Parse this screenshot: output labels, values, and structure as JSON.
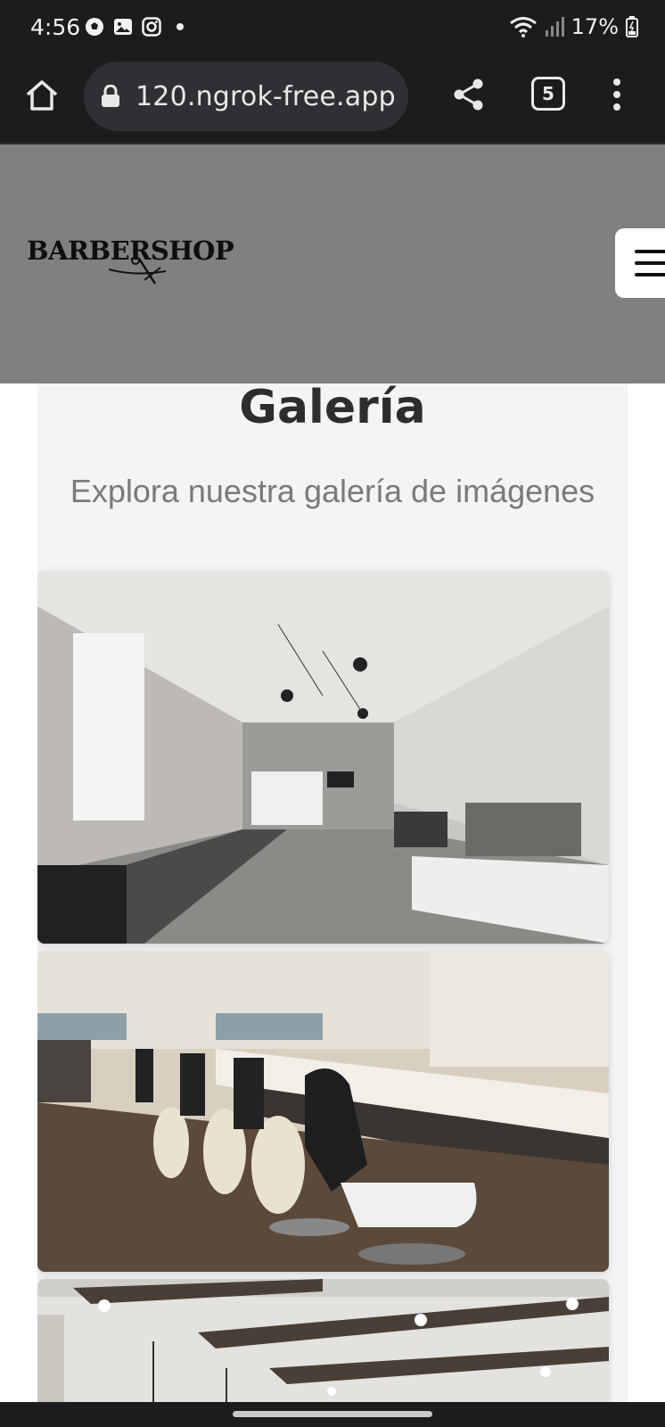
{
  "status_bar": {
    "time": "4:56",
    "battery": "17%",
    "icons_left": [
      "soccer-ball-icon",
      "gallery-icon",
      "instagram-icon",
      "dot-icon"
    ],
    "icons_right": [
      "wifi-icon",
      "signal-icon",
      "battery-icon"
    ]
  },
  "browser": {
    "url": "120.ngrok-free.app",
    "tab_count": "5",
    "icons": [
      "home-icon",
      "lock-icon",
      "share-icon",
      "tabs-icon",
      "more-vert-icon"
    ]
  },
  "site_header": {
    "logo_text_part1": "Barber",
    "logo_text_part2": "Shop",
    "menu_icon": "hamburger-icon"
  },
  "gallery": {
    "title": "Galería",
    "subtitle": "Explora nuestra galería de imágenes",
    "images": [
      {
        "subject": "barbershop-interior-modern"
      },
      {
        "subject": "barbershop-chairs-row"
      },
      {
        "subject": "barbershop-ceiling-lights"
      }
    ]
  },
  "colors": {
    "header_bg": "#808080",
    "gallery_bg": "#f4f4f4",
    "browser_bg": "#1b1c1e"
  }
}
